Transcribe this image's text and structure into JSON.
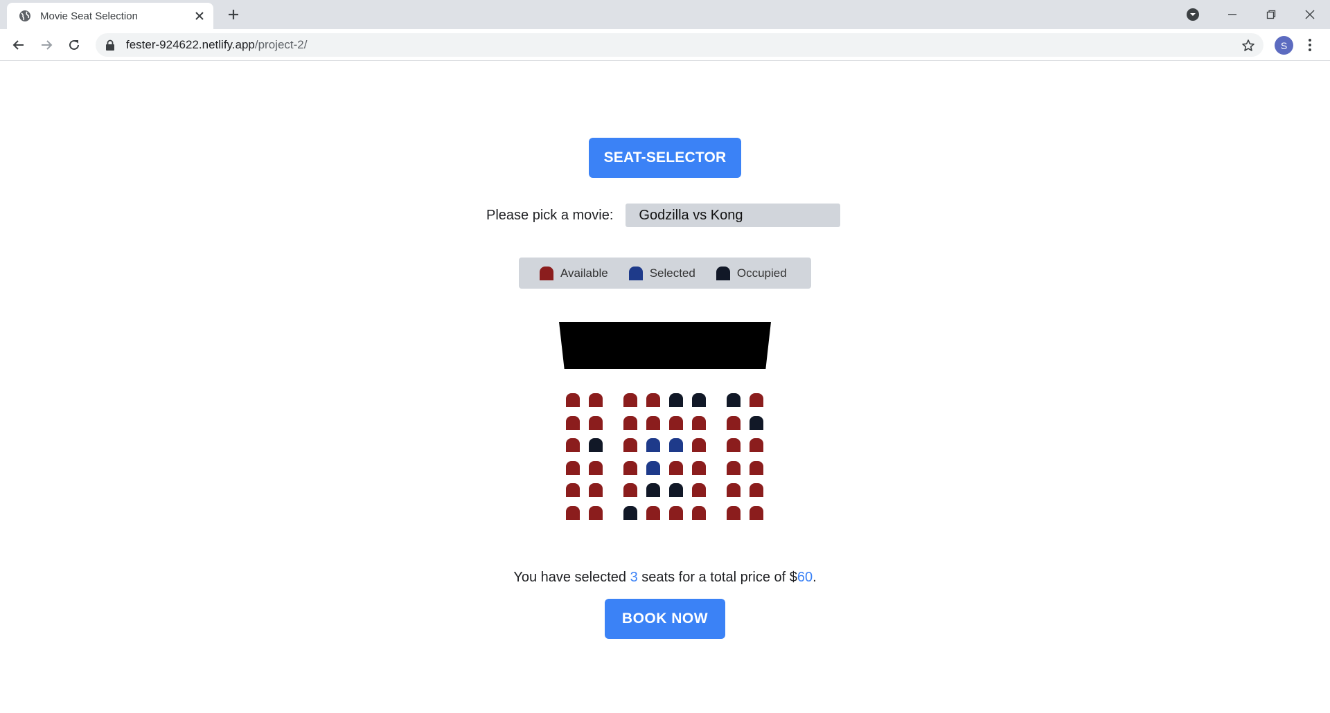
{
  "browser": {
    "tab_title": "Movie Seat Selection",
    "url_host": "fester-924622.netlify.app",
    "url_path": "/project-2/",
    "profile_initial": "S"
  },
  "page": {
    "title_button": "SEAT-SELECTOR",
    "picker_label": "Please pick a movie:",
    "selected_movie": "Godzilla vs Kong",
    "legend": [
      {
        "label": "Available",
        "status": "available"
      },
      {
        "label": "Selected",
        "status": "selected"
      },
      {
        "label": "Occupied",
        "status": "occupied"
      }
    ],
    "summary": {
      "prefix": "You have selected ",
      "count": "3",
      "middle": " seats for a total price of $",
      "total": "60",
      "suffix": "."
    },
    "book_button": "BOOK NOW"
  },
  "colors": {
    "accent": "#3b82f6",
    "available": "#8b1d1d",
    "selected": "#1e3a8a",
    "occupied": "#111827"
  },
  "seat_rows": [
    [
      "available",
      "available",
      "available",
      "available",
      "occupied",
      "occupied",
      "occupied",
      "available"
    ],
    [
      "available",
      "available",
      "available",
      "available",
      "available",
      "available",
      "available",
      "occupied"
    ],
    [
      "available",
      "occupied",
      "available",
      "selected",
      "selected",
      "available",
      "available",
      "available"
    ],
    [
      "available",
      "available",
      "available",
      "selected",
      "available",
      "available",
      "available",
      "available"
    ],
    [
      "available",
      "available",
      "available",
      "occupied",
      "occupied",
      "available",
      "available",
      "available"
    ],
    [
      "available",
      "available",
      "occupied",
      "available",
      "available",
      "available",
      "available",
      "available"
    ]
  ]
}
